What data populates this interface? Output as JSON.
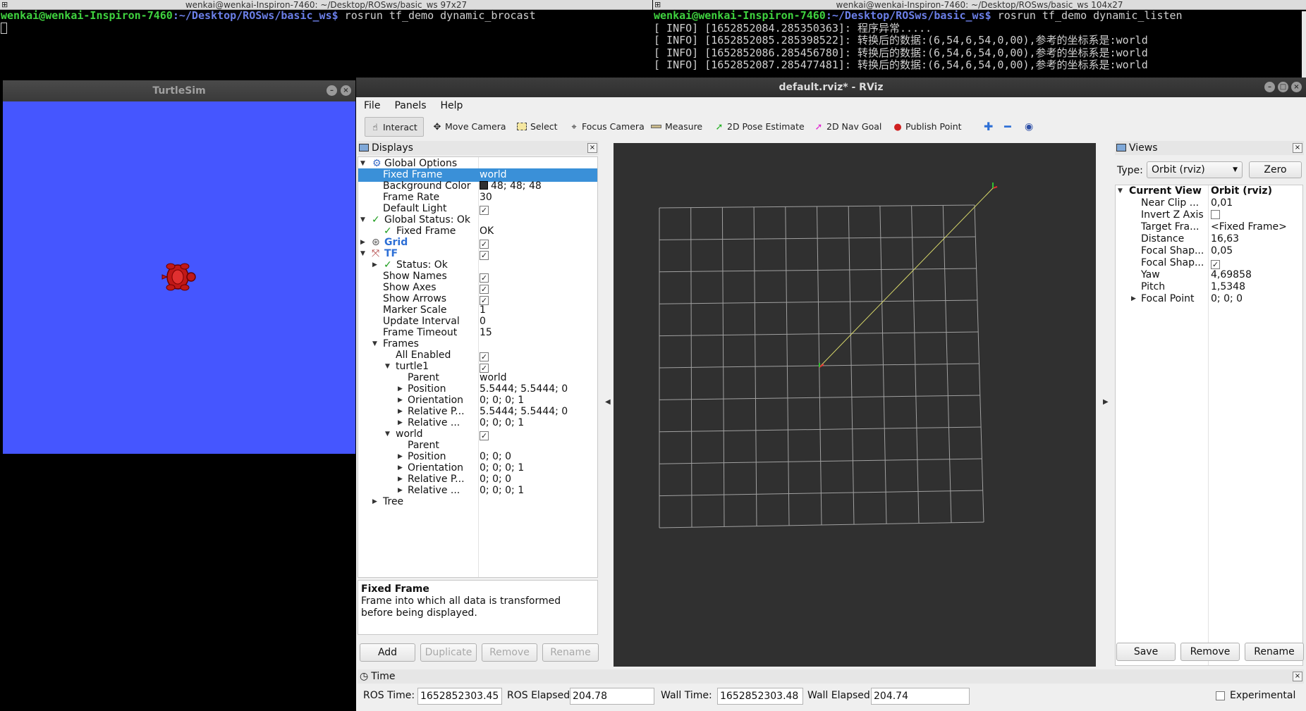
{
  "left_terminal": {
    "title": "wenkai@wenkai-Inspiron-7460: ~/Desktop/ROSws/basic_ws 97x27",
    "prompt_user": "wenkai@wenkai-Inspiron-7460",
    "prompt_path": ":~/Desktop/ROSws/basic_ws$",
    "command": " rosrun tf_demo dynamic_brocast"
  },
  "right_terminal": {
    "title": "wenkai@wenkai-Inspiron-7460: ~/Desktop/ROSws/basic_ws 104x27",
    "prompt_user": "wenkai@wenkai-Inspiron-7460",
    "prompt_path": ":~/Desktop/ROSws/basic_ws$",
    "command": " rosrun tf_demo dynamic_listen",
    "lines": [
      "[ INFO] [1652852084.285350363]: 程序异常.....",
      "[ INFO] [1652852085.285398522]: 转换后的数据:(6,54,6,54,0,00),参考的坐标系是:world",
      "[ INFO] [1652852086.285456780]: 转换后的数据:(6,54,6,54,0,00),参考的坐标系是:world",
      "[ INFO] [1652852087.285477481]: 转换后的数据:(6,54,6,54,0,00),参考的坐标系是:world"
    ]
  },
  "turtlesim": {
    "title": "TurtleSim",
    "background": "#4556ff"
  },
  "rviz": {
    "title": "default.rviz* - RViz",
    "menu": [
      "File",
      "Panels",
      "Help"
    ],
    "tools": [
      "Interact",
      "Move Camera",
      "Select",
      "Focus Camera",
      "Measure",
      "2D Pose Estimate",
      "2D Nav Goal",
      "Publish Point"
    ],
    "displays": {
      "title": "Displays",
      "rows": [
        {
          "label": "Global Options",
          "value": ""
        },
        {
          "label": "Fixed Frame",
          "value": "world"
        },
        {
          "label": "Background Color",
          "value": "48; 48; 48"
        },
        {
          "label": "Frame Rate",
          "value": "30"
        },
        {
          "label": "Default Light",
          "value": ""
        },
        {
          "label": "Global Status: Ok",
          "value": ""
        },
        {
          "label": "Fixed Frame",
          "value": "OK"
        },
        {
          "label": "Grid",
          "value": ""
        },
        {
          "label": "TF",
          "value": ""
        },
        {
          "label": "Status: Ok",
          "value": ""
        },
        {
          "label": "Show Names",
          "value": ""
        },
        {
          "label": "Show Axes",
          "value": ""
        },
        {
          "label": "Show Arrows",
          "value": ""
        },
        {
          "label": "Marker Scale",
          "value": "1"
        },
        {
          "label": "Update Interval",
          "value": "0"
        },
        {
          "label": "Frame Timeout",
          "value": "15"
        },
        {
          "label": "Frames",
          "value": ""
        },
        {
          "label": "All Enabled",
          "value": ""
        },
        {
          "label": "turtle1",
          "value": ""
        },
        {
          "label": "Parent",
          "value": "world"
        },
        {
          "label": "Position",
          "value": "5.5444; 5.5444; 0"
        },
        {
          "label": "Orientation",
          "value": "0; 0; 0; 1"
        },
        {
          "label": "Relative P...",
          "value": "5.5444; 5.5444; 0"
        },
        {
          "label": "Relative ...",
          "value": "0; 0; 0; 1"
        },
        {
          "label": "world",
          "value": ""
        },
        {
          "label": "Parent",
          "value": ""
        },
        {
          "label": "Position",
          "value": "0; 0; 0"
        },
        {
          "label": "Orientation",
          "value": "0; 0; 0; 1"
        },
        {
          "label": "Relative P...",
          "value": "0; 0; 0"
        },
        {
          "label": "Relative ...",
          "value": "0; 0; 0; 1"
        },
        {
          "label": "Tree",
          "value": ""
        }
      ],
      "description_title": "Fixed Frame",
      "description_text": "Frame into which all data is transformed before being displayed.",
      "buttons": [
        "Add",
        "Duplicate",
        "Remove",
        "Rename"
      ]
    },
    "views": {
      "title": "Views",
      "type_label": "Type:",
      "type_value": "Orbit (rviz)",
      "zero_label": "Zero",
      "current_view_label": "Current View",
      "current_view_value": "Orbit (rviz)",
      "rows": [
        {
          "label": "Near Clip ...",
          "value": "0,01"
        },
        {
          "label": "Invert Z Axis",
          "value": ""
        },
        {
          "label": "Target Fra...",
          "value": "<Fixed Frame>"
        },
        {
          "label": "Distance",
          "value": "16,63"
        },
        {
          "label": "Focal Shap...",
          "value": "0,05"
        },
        {
          "label": "Focal Shap...",
          "value": ""
        },
        {
          "label": "Yaw",
          "value": "4,69858"
        },
        {
          "label": "Pitch",
          "value": "1,5348"
        },
        {
          "label": "Focal Point",
          "value": "0; 0; 0"
        }
      ],
      "buttons": [
        "Save",
        "Remove",
        "Rename"
      ]
    },
    "time": {
      "title": "Time",
      "ros_time_label": "ROS Time:",
      "ros_time": "1652852303.45",
      "ros_elapsed_label": "ROS Elapsed:",
      "ros_elapsed": "204.78",
      "wall_time_label": "Wall Time:",
      "wall_time": "1652852303.48",
      "wall_elapsed_label": "Wall Elapsed:",
      "wall_elapsed": "204.74",
      "experimental_label": "Experimental"
    }
  }
}
